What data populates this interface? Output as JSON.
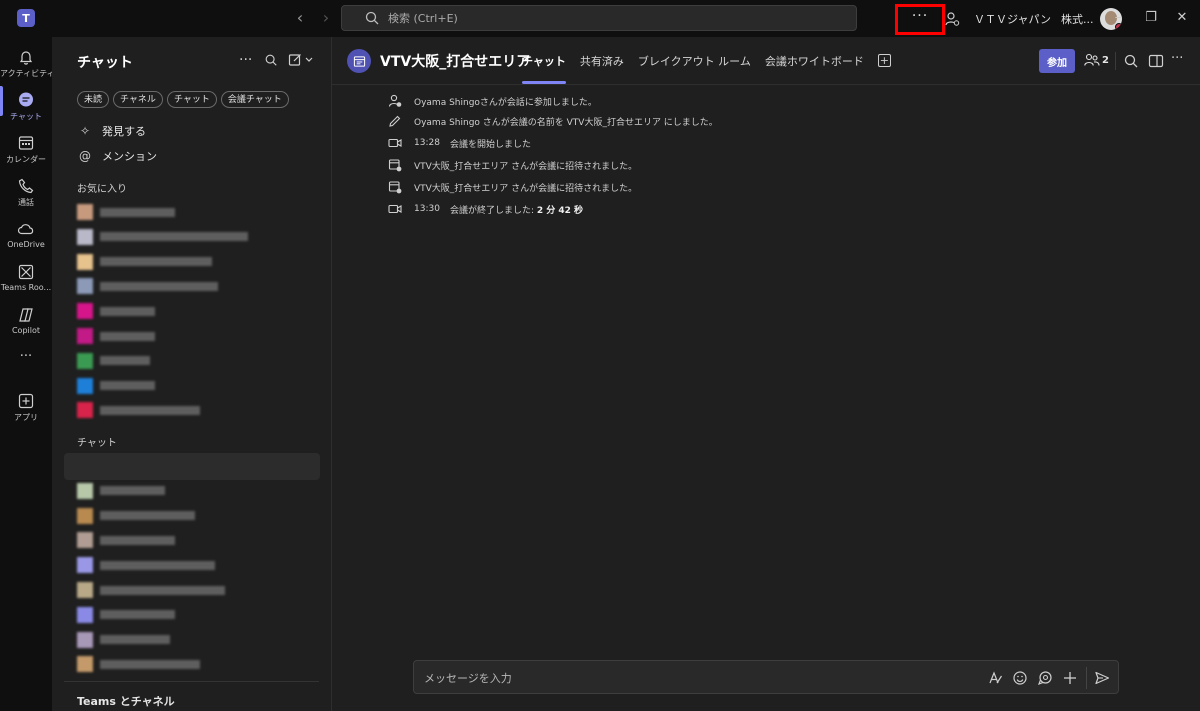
{
  "titlebar": {
    "app_logo": "T",
    "search_placeholder": "検索 (Ctrl+E)",
    "more_label": "···",
    "org_name": "ＶＴＶジャパン",
    "org_short": "株式...",
    "icons": [
      "teams-logo-icon",
      "back-arrow-icon",
      "forward-arrow-icon",
      "search-icon",
      "more-icon",
      "person-icon",
      "minimize-icon",
      "restore-icon",
      "close-icon"
    ]
  },
  "rail": {
    "items": [
      {
        "label": "アクティビティ",
        "icon": "bell-icon"
      },
      {
        "label": "チャット",
        "icon": "chat-icon"
      },
      {
        "label": "カレンダー",
        "icon": "calendar-icon"
      },
      {
        "label": "通話",
        "icon": "phone-icon"
      },
      {
        "label": "OneDrive",
        "icon": "cloud-icon"
      },
      {
        "label": "Teams Roo...",
        "icon": "rooms-icon"
      },
      {
        "label": "Copilot",
        "icon": "copilot-icon"
      },
      {
        "label": "···",
        "icon": "more-icon"
      },
      {
        "label": "アプリ",
        "icon": "apps-icon"
      }
    ]
  },
  "chatlist": {
    "title": "チャット",
    "filters": [
      "未読",
      "チャネル",
      "チャット",
      "会議チャット"
    ],
    "discover": "発見する",
    "mentions": "メンション",
    "favorites_label": "お気に入り",
    "chats_label": "チャット",
    "teams_label": "Teams とチャネル",
    "colors": {
      "favorites": [
        "#c79a7e",
        "#b8b8c8",
        "#e6c28c",
        "#8c9ab8",
        "#d6158a",
        "#c21a86",
        "#3a9a52",
        "#1e7fd8",
        "#d8234a"
      ],
      "chats": [
        "#9a98e6",
        "#b7c8a8",
        "#b88a50",
        "#b09c92",
        "#9a98e6",
        "#b8a888",
        "#8a8ae6",
        "#a898b8",
        "#c49a6a"
      ]
    }
  },
  "channel": {
    "title": "VTV大阪_打合せエリア",
    "tabs": [
      "チャット",
      "共有済み",
      "ブレイクアウト ルーム",
      "会議ホワイトボード"
    ],
    "join_label": "参加",
    "participants_count": "2"
  },
  "events": [
    {
      "text": "Oyama Shingoさんが会話に参加しました。",
      "icon": "person-add-icon"
    },
    {
      "text": "Oyama Shingo さんが会議の名前を VTV大阪_打合せエリア にしました。",
      "icon": "pencil-icon"
    },
    {
      "time": "13:28",
      "text": "会議を開始しました",
      "icon": "video-icon"
    },
    {
      "text": "VTV大阪_打合せエリア さんが会議に招待されました。",
      "icon": "calendar-add-icon"
    },
    {
      "text": "VTV大阪_打合せエリア さんが会議に招待されました。",
      "icon": "calendar-add-icon"
    },
    {
      "time": "13:30",
      "text": "会議が終了しました: ",
      "duration": "2 分 42 秒",
      "icon": "video-icon"
    }
  ],
  "composer": {
    "placeholder": "メッセージを入力",
    "icons": [
      "format-icon",
      "emoji-icon",
      "loop-icon",
      "plus-icon",
      "send-icon"
    ]
  },
  "annotation": {
    "color": "#ff0000"
  }
}
